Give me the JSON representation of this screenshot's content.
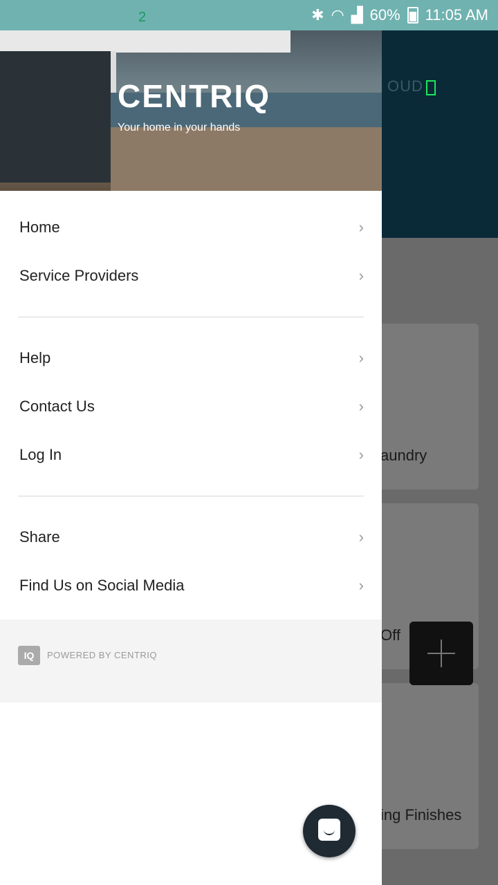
{
  "status_bar": {
    "battery": "60%",
    "time": "11:05 AM",
    "notification_count": "2"
  },
  "background": {
    "header_text": "OUD",
    "cards": [
      {
        "label": "aundry"
      },
      {
        "label": "Off"
      },
      {
        "label": "ing Finishes"
      }
    ]
  },
  "drawer": {
    "logo": "CENTRIQ",
    "tagline": "Your home in your hands",
    "group1": [
      {
        "label": "Home"
      },
      {
        "label": "Service Providers"
      }
    ],
    "group2": [
      {
        "label": "Help"
      },
      {
        "label": "Contact Us"
      },
      {
        "label": "Log In"
      }
    ],
    "group3": [
      {
        "label": "Share"
      },
      {
        "label": "Find Us on Social Media"
      }
    ],
    "powered_by": "POWERED BY CENTRIQ",
    "powered_icon": "IQ",
    "chevron": "›"
  },
  "icons": {
    "wifi": "wifi-icon",
    "bluetooth": "bluetooth-icon",
    "signal": "signal-icon",
    "battery": "battery-icon",
    "chat": "chat-icon",
    "plus": "plus-icon",
    "menu": "menu-icon"
  },
  "colors": {
    "status_bar": "#6fb2b0",
    "drawer_bg": "#ffffff",
    "hero_overlay": "#0a2a38",
    "chat_fab": "#1f2a33"
  }
}
